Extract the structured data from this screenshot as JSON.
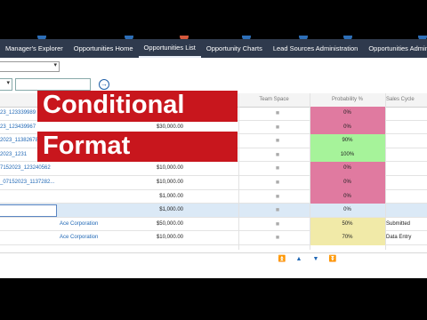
{
  "nav": {
    "tabs": [
      {
        "label": "Manager's Explorer",
        "active": false
      },
      {
        "label": "Opportunities Home",
        "active": false
      },
      {
        "label": "Opportunities List",
        "active": true
      },
      {
        "label": "Opportunity Charts",
        "active": false
      },
      {
        "label": "Lead Sources Administration",
        "active": false
      },
      {
        "label": "Opportunities Administratio",
        "active": false
      }
    ]
  },
  "search": {
    "value": "",
    "go_icon": "arrow-right-circle-icon"
  },
  "grid": {
    "headers": {
      "team_space": "Team Space",
      "probability": "Probability %",
      "sales_cycle": "Sales Cycle"
    },
    "rows": [
      {
        "name": "23_123339989",
        "account": "",
        "amount": "",
        "team": "■",
        "probability": "0%",
        "sales_cycle": "",
        "prob_color": "#e07aa0",
        "selected": false
      },
      {
        "name": "23_123439967",
        "account": "",
        "amount": "$30,000.00",
        "team": "■",
        "probability": "0%",
        "sales_cycle": "",
        "prob_color": "#e07aa0",
        "selected": false
      },
      {
        "name": "2023_11382678",
        "account": "",
        "amount": "",
        "team": "■",
        "probability": "90%",
        "sales_cycle": "",
        "prob_color": "#a6f39a",
        "selected": false
      },
      {
        "name": "2023_1231",
        "account": "",
        "amount": "",
        "team": "■",
        "probability": "100%",
        "sales_cycle": "",
        "prob_color": "#a6f39a",
        "selected": false
      },
      {
        "name": "7152023_123240562",
        "account": "",
        "amount": "$10,000.00",
        "team": "■",
        "probability": "0%",
        "sales_cycle": "",
        "prob_color": "#e07aa0",
        "selected": false
      },
      {
        "name": "_07152023_1137282...",
        "account": "",
        "amount": "$10,000.00",
        "team": "■",
        "probability": "0%",
        "sales_cycle": "",
        "prob_color": "#e07aa0",
        "selected": false
      },
      {
        "name": "",
        "account": "",
        "amount": "$1,000.00",
        "team": "■",
        "probability": "0%",
        "sales_cycle": "",
        "prob_color": "#e07aa0",
        "selected": false
      },
      {
        "name": "",
        "account": "",
        "amount": "$1,000.00",
        "team": "■",
        "probability": "0%",
        "sales_cycle": "",
        "prob_color": "",
        "selected": true
      },
      {
        "name": "",
        "account": "Ace Corporation",
        "amount": "$50,000.00",
        "team": "■",
        "probability": "50%",
        "sales_cycle": "Submitted",
        "prob_color": "#f1eaa8",
        "selected": false
      },
      {
        "name": "",
        "account": "Ace Corporation",
        "amount": "$10,000.00",
        "team": "■",
        "probability": "70%",
        "sales_cycle": "Data Entry",
        "prob_color": "#f1eaa8",
        "selected": false
      }
    ]
  },
  "pager": {
    "first": "⏫",
    "prev": "▲",
    "next": "▼",
    "last": "⏬"
  },
  "overlay": {
    "line1": "Conditional",
    "line2": "Format"
  },
  "colors": {
    "nav_bg": "#2f3a4d",
    "banner_red": "#c8161d",
    "pink": "#e07aa0",
    "green": "#a6f39a",
    "yellow": "#f1eaa8"
  }
}
